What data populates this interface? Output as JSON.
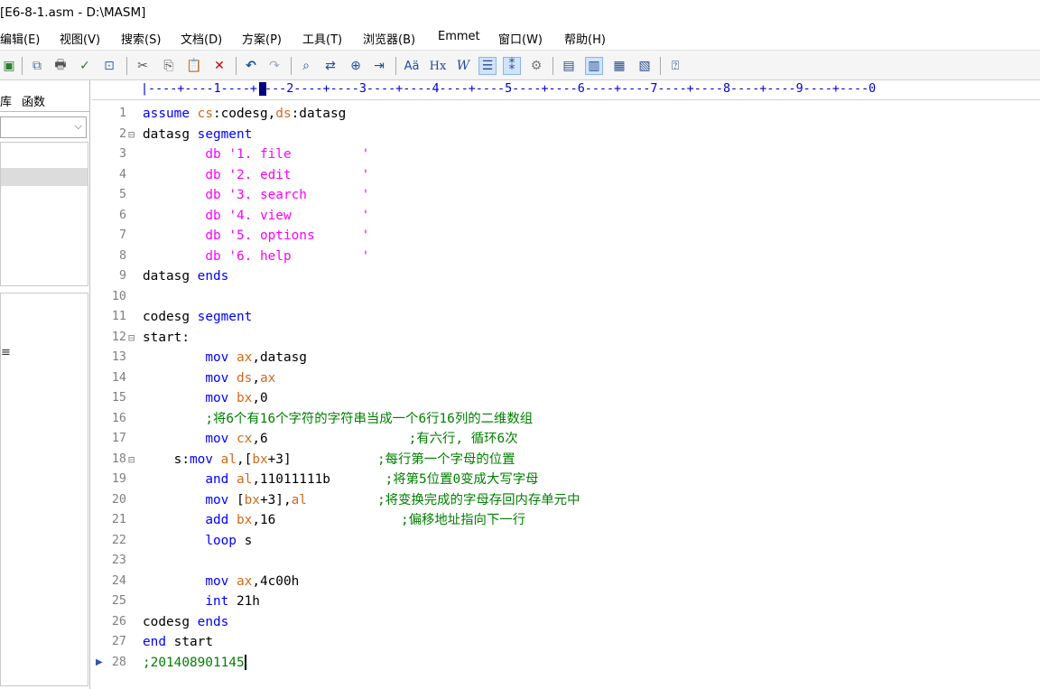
{
  "window": {
    "title": "[E6-8-1.asm - D:\\MASM]"
  },
  "menu": [
    "编辑(E)",
    "视图(V)",
    "搜索(S)",
    "文档(D)",
    "方案(P)",
    "工具(T)",
    "浏览器(B)",
    "Emmet",
    "窗口(W)",
    "帮助(H)"
  ],
  "toolbar": {
    "icons": [
      "save-icon",
      "new-tab-icon",
      "print-icon",
      "spellcheck-icon",
      "preview-icon",
      "cut-icon",
      "copy-icon",
      "paste-icon",
      "delete-icon",
      "undo-icon",
      "redo-icon",
      "find-icon",
      "replace-icon",
      "find-in-files-icon",
      "goto-icon",
      "font-format-icon",
      "heading-icon",
      "word-wrap-icon",
      "align-icon",
      "line-numbers-icon",
      "settings-icon",
      "window-1-icon",
      "window-2-icon",
      "window-3-icon",
      "window-4-icon",
      "help-pointer-icon"
    ],
    "glyphs": [
      "▣",
      "⧉",
      "🖶",
      "✓",
      "⊡",
      "✂",
      "⎘",
      "📋",
      "✕",
      "↶",
      "↷",
      "⌕",
      "⇄",
      "⊕",
      "⇥",
      "Aä",
      "Hx",
      "W",
      "☰",
      "⁑",
      "⚙",
      "▤",
      "▥",
      "▦",
      "▧",
      "⍰"
    ],
    "accent": "#cfe3fb"
  },
  "leftpane": {
    "tab1": "库",
    "tab2": "函数",
    "combo_value": "",
    "fragment": "≡"
  },
  "ruler": "|----+----1----+----2----+----3----+----4----+----5----+----6----+----7----+----8----+----9----+----0",
  "lines": [
    {
      "n": "1",
      "fold": ""
    },
    {
      "n": "2",
      "fold": "⊟"
    },
    {
      "n": "3",
      "fold": ""
    },
    {
      "n": "4",
      "fold": ""
    },
    {
      "n": "5",
      "fold": ""
    },
    {
      "n": "6",
      "fold": ""
    },
    {
      "n": "7",
      "fold": ""
    },
    {
      "n": "8",
      "fold": ""
    },
    {
      "n": "9",
      "fold": ""
    },
    {
      "n": "10",
      "fold": ""
    },
    {
      "n": "11",
      "fold": ""
    },
    {
      "n": "12",
      "fold": "⊟"
    },
    {
      "n": "13",
      "fold": ""
    },
    {
      "n": "14",
      "fold": ""
    },
    {
      "n": "15",
      "fold": ""
    },
    {
      "n": "16",
      "fold": ""
    },
    {
      "n": "17",
      "fold": ""
    },
    {
      "n": "18",
      "fold": "⊟"
    },
    {
      "n": "19",
      "fold": ""
    },
    {
      "n": "20",
      "fold": ""
    },
    {
      "n": "21",
      "fold": ""
    },
    {
      "n": "22",
      "fold": ""
    },
    {
      "n": "23",
      "fold": ""
    },
    {
      "n": "24",
      "fold": ""
    },
    {
      "n": "25",
      "fold": ""
    },
    {
      "n": "26",
      "fold": ""
    },
    {
      "n": "27",
      "fold": ""
    },
    {
      "n": "28",
      "fold": ""
    }
  ],
  "code": {
    "l1": [
      "assume",
      " ",
      "cs",
      ":codesg,",
      "ds",
      ":datasg"
    ],
    "l2": [
      "datasg",
      " ",
      "segment"
    ],
    "l3": [
      "        ",
      "db",
      " ",
      "'1. file         '"
    ],
    "l4": [
      "        ",
      "db",
      " ",
      "'2. edit         '"
    ],
    "l5": [
      "        ",
      "db",
      " ",
      "'3. search       '"
    ],
    "l6": [
      "        ",
      "db",
      " ",
      "'4. view         '"
    ],
    "l7": [
      "        ",
      "db",
      " ",
      "'5. options      '"
    ],
    "l8": [
      "        ",
      "db",
      " ",
      "'6. help         '"
    ],
    "l9": [
      "datasg",
      " ",
      "ends"
    ],
    "l11": [
      "codesg",
      " ",
      "segment"
    ],
    "l12": [
      "start:"
    ],
    "l13": [
      "        ",
      "mov",
      " ",
      "ax",
      ",datasg"
    ],
    "l14": [
      "        ",
      "mov",
      " ",
      "ds",
      ",",
      "ax"
    ],
    "l15": [
      "        ",
      "mov",
      " ",
      "bx",
      ",0"
    ],
    "l16": [
      "        ",
      ";将6个有16个字符的字符串当成一个6行16列的二维数组"
    ],
    "l17": [
      "        ",
      "mov",
      " ",
      "cx",
      ",6",
      "                  ",
      ";有六行, 循环6次"
    ],
    "l18": [
      "    ",
      "s:",
      "mov",
      " ",
      "al",
      ",[",
      "bx",
      "+3]",
      "           ",
      ";每行第一个字母的位置"
    ],
    "l19": [
      "        ",
      "and",
      " ",
      "al",
      ",11011111b",
      "       ",
      ";将第5位置0变成大写字母"
    ],
    "l20": [
      "        ",
      "mov",
      " [",
      "bx",
      "+3],",
      "al",
      "         ",
      ";将变换完成的字母存回内存单元中"
    ],
    "l21": [
      "        ",
      "add",
      " ",
      "bx",
      ",16",
      "                ",
      ";偏移地址指向下一行"
    ],
    "l22": [
      "        ",
      "loop",
      " s"
    ],
    "l24": [
      "        ",
      "mov",
      " ",
      "ax",
      ",4c00h"
    ],
    "l25": [
      "        ",
      "int",
      " 21h"
    ],
    "l26": [
      "codesg",
      " ",
      "ends"
    ],
    "l27": [
      "end",
      " start"
    ],
    "l28": [
      ";201408901145"
    ]
  }
}
